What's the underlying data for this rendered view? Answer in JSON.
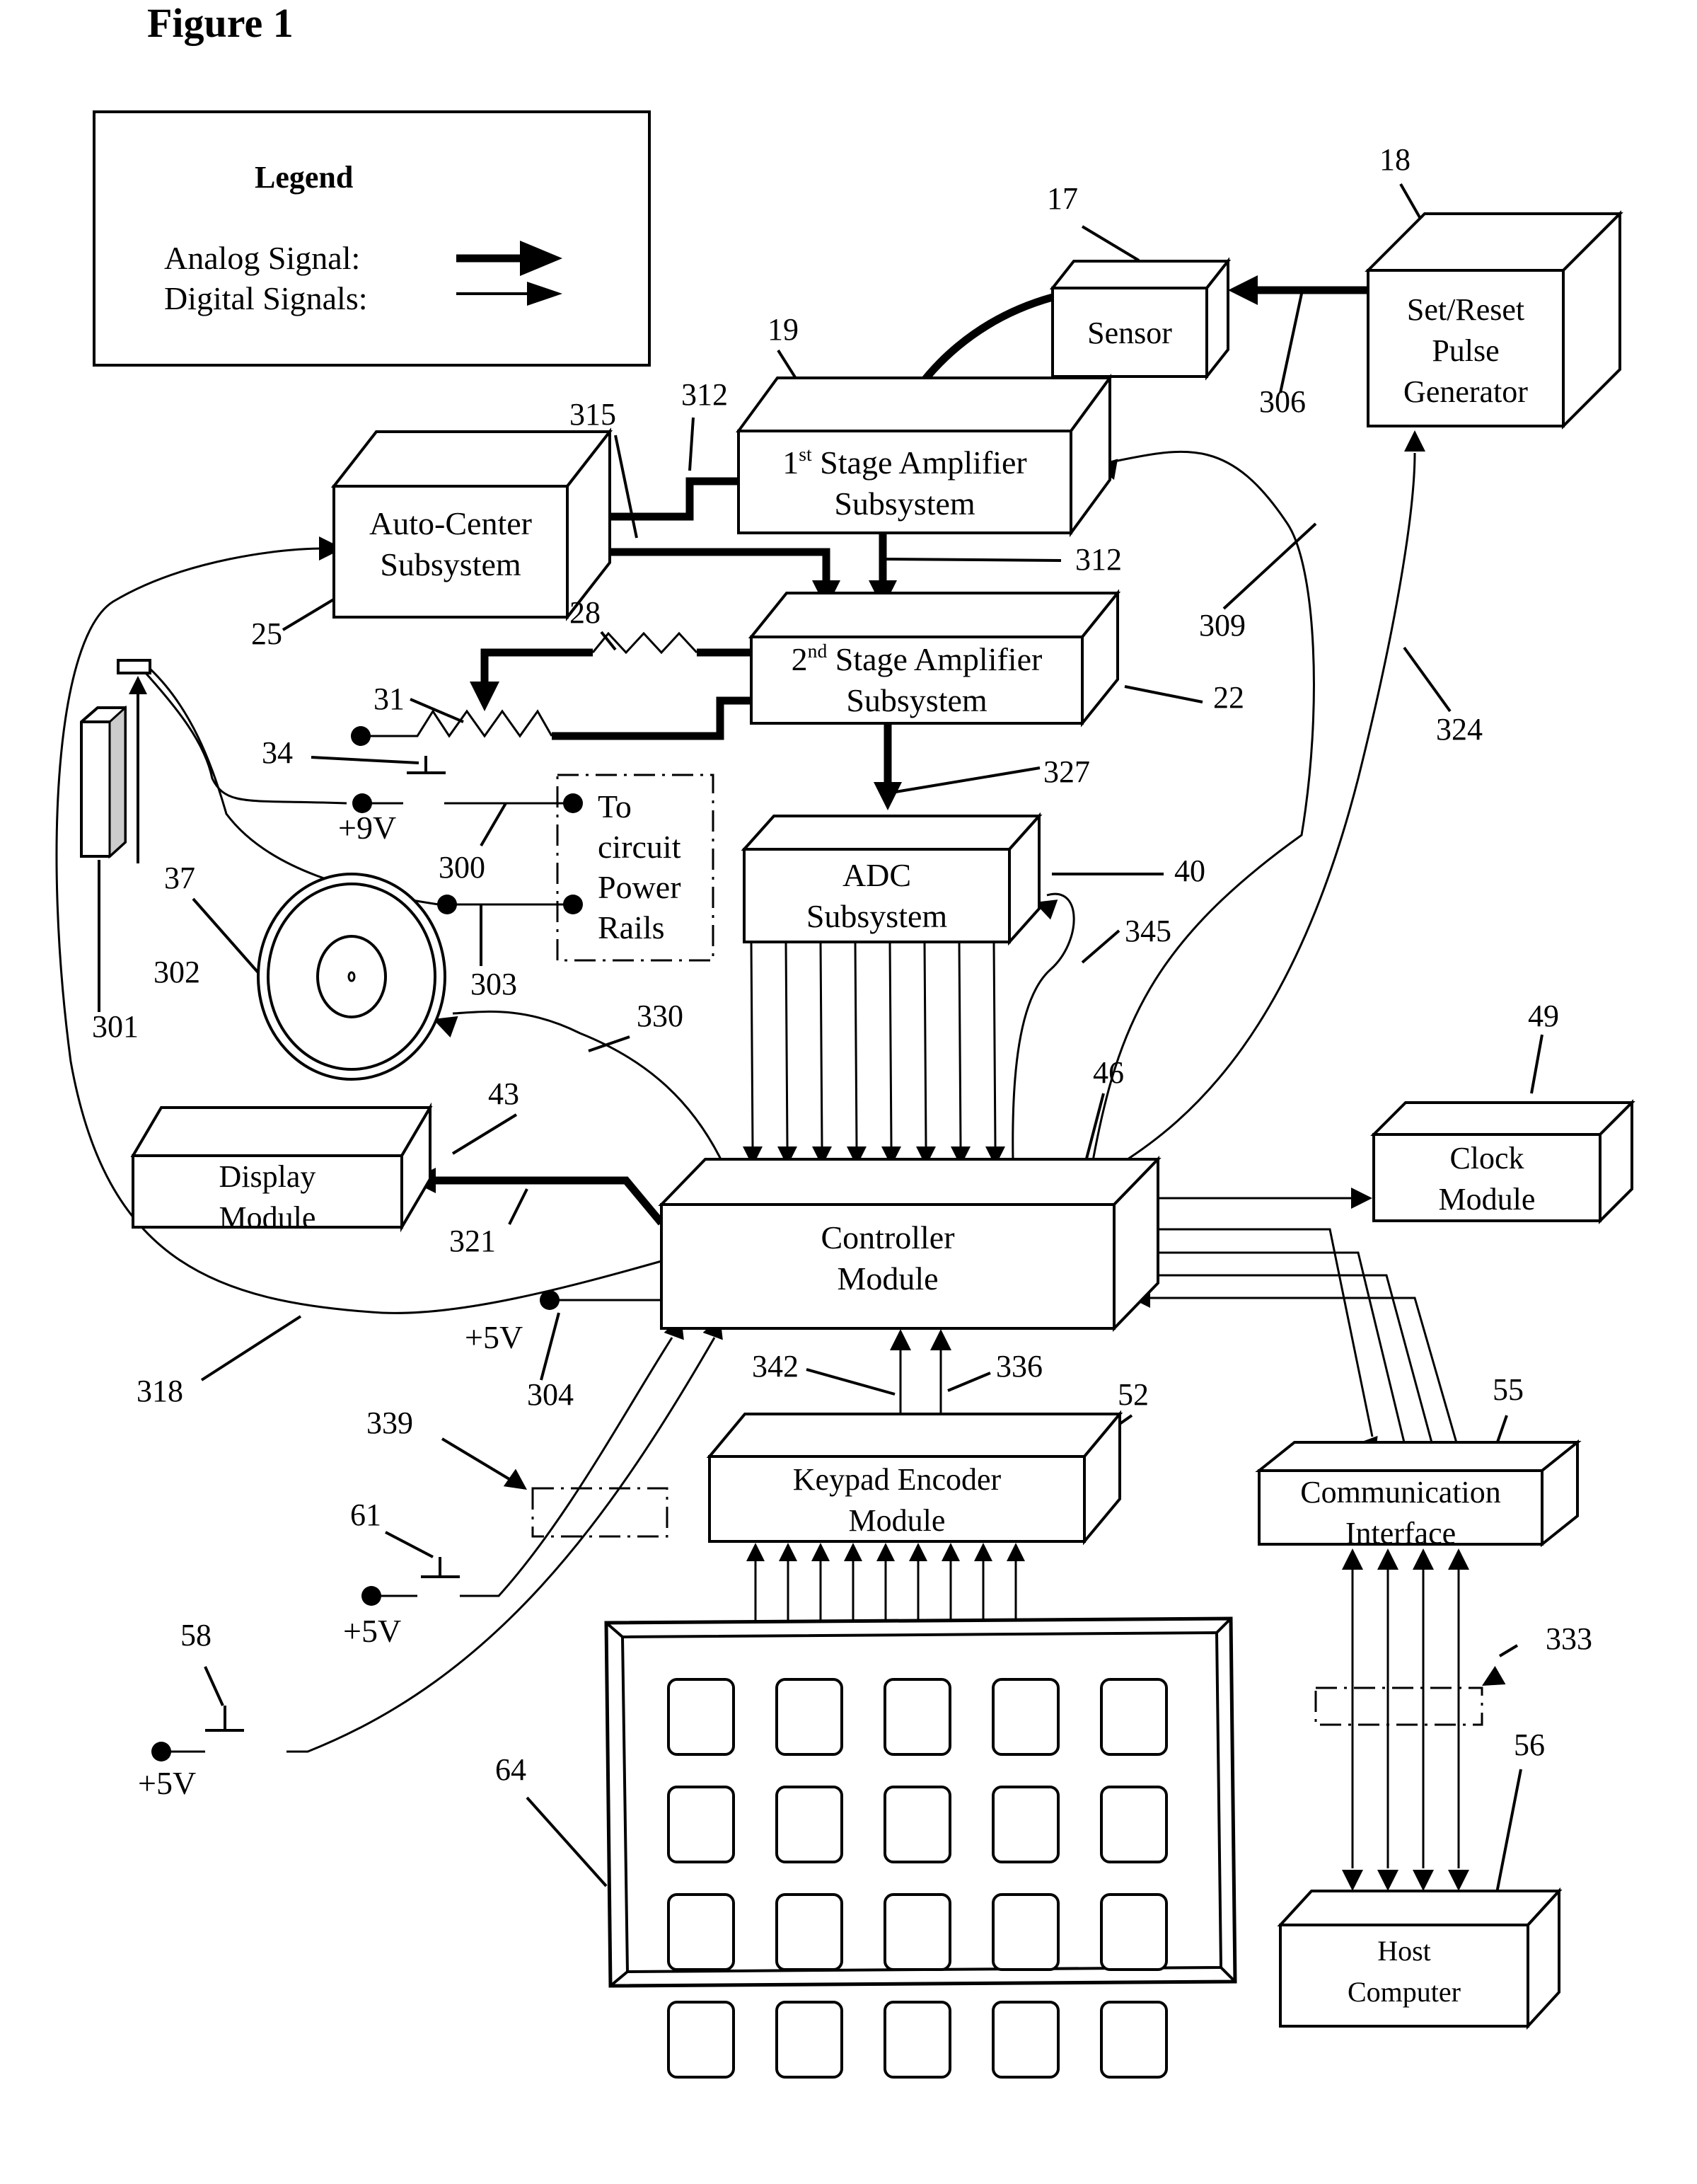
{
  "figure": {
    "title": "Figure 1"
  },
  "legend": {
    "title": "Legend",
    "items": [
      {
        "label": "Analog Signal:",
        "kind": "analog"
      },
      {
        "label": "Digital Signals:",
        "kind": "digital"
      }
    ]
  },
  "blocks": {
    "sensor": {
      "lines": [
        "Sensor"
      ],
      "ref": "17"
    },
    "pulse_generator": {
      "lines": [
        "Set/Reset",
        "Pulse",
        "Generator"
      ],
      "ref": "18"
    },
    "first_stage": {
      "lines": [
        "1st Stage Amplifier",
        "Subsystem"
      ],
      "sup": "st",
      "ref": "19"
    },
    "auto_center": {
      "lines": [
        "Auto-Center",
        "Subsystem"
      ],
      "ref": "25"
    },
    "second_stage": {
      "lines": [
        "2nd Stage Amplifier",
        "Subsystem"
      ],
      "sup": "nd",
      "ref": "22"
    },
    "adc": {
      "lines": [
        "ADC",
        "Subsystem"
      ],
      "ref": "40"
    },
    "display": {
      "lines": [
        "Display",
        "Module"
      ],
      "ref": "43"
    },
    "controller": {
      "lines": [
        "Controller",
        "Module"
      ],
      "ref": "46"
    },
    "clock": {
      "lines": [
        "Clock",
        "Module"
      ],
      "ref": "49"
    },
    "keypad_encoder": {
      "lines": [
        "Keypad Encoder",
        "Module"
      ],
      "ref": "52"
    },
    "comm_interface": {
      "lines": [
        "Communication",
        "Interface"
      ],
      "ref": "55"
    },
    "host_computer": {
      "lines": [
        "Host",
        "Computer"
      ],
      "ref": "56"
    }
  },
  "components": {
    "resistor": {
      "ref": "28"
    },
    "potentiometer": {
      "ref": "31"
    },
    "ground_34": {
      "ref": "34"
    },
    "speaker": {
      "ref": "37"
    },
    "battery": {
      "ref": "301"
    },
    "battery_connector": {
      "ref": "302"
    },
    "switch_58": {
      "ref": "58"
    },
    "switch_61": {
      "ref": "61"
    },
    "keypad": {
      "ref": "64",
      "rows": 4,
      "cols": 5
    },
    "power_rails_box": {
      "lines": [
        "To",
        "circuit",
        "Power",
        "Rails"
      ]
    },
    "optional_339": {
      "ref": "339"
    },
    "optional_333": {
      "ref": "333"
    }
  },
  "voltages": {
    "v9": "+9V",
    "v5a": "+5V",
    "v5b": "+5V",
    "v5c": "+5V"
  },
  "signals": {
    "s300": "300",
    "s303": "303",
    "s304": "304",
    "s306": "306",
    "s309": "309",
    "s312a": "312",
    "s312b": "312",
    "s315": "315",
    "s318": "318",
    "s321": "321",
    "s324": "324",
    "s327": "327",
    "s330": "330",
    "s336": "336",
    "s342": "342",
    "s345": "345"
  },
  "adc_bus_lines": 8,
  "keypad_bus_lines": 9,
  "comm_bus_lines": 4
}
